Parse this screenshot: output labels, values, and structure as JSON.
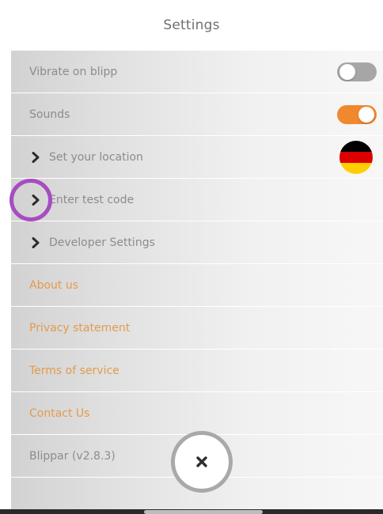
{
  "header": {
    "title": "Settings"
  },
  "settings": {
    "vibrate": {
      "label": "Vibrate on blipp",
      "state": "off"
    },
    "sounds": {
      "label": "Sounds",
      "state": "on"
    },
    "location": {
      "label": "Set your location",
      "flag": "germany"
    },
    "test_code": {
      "label": "Enter test code"
    },
    "developer": {
      "label": "Developer Settings"
    },
    "about": {
      "label": "About us"
    },
    "privacy": {
      "label": "Privacy statement"
    },
    "terms": {
      "label": "Terms of service"
    },
    "contact": {
      "label": "Contact Us"
    },
    "version": {
      "label": "Blippar (v2.8.3)"
    }
  },
  "icons": {
    "chevron": "chevron-right-icon",
    "close": "close-icon"
  },
  "colors": {
    "accent_orange": "#f0882e",
    "link_orange": "#e49a4c",
    "highlight_purple": "#a84cc0",
    "toggle_off": "#a6a6a6",
    "flag_black": "#000000",
    "flag_red": "#dd0000",
    "flag_gold": "#ffce00"
  }
}
